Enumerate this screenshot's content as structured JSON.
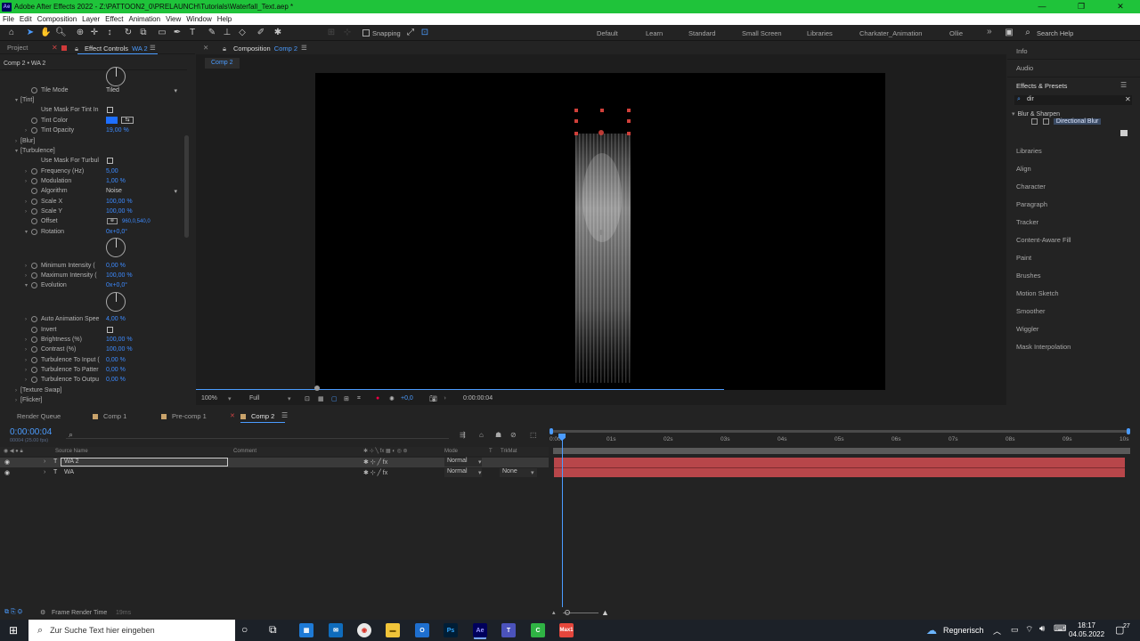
{
  "window": {
    "title": "Adobe After Effects 2022 - Z:\\PATTOON2_0\\PRELAUNCH\\Tutorials\\Waterfall_Text.aep *",
    "app_badge": "Ae",
    "controls": [
      "—",
      "❐",
      "✕"
    ]
  },
  "menu": [
    "File",
    "Edit",
    "Composition",
    "Layer",
    "Effect",
    "Animation",
    "View",
    "Window",
    "Help"
  ],
  "toolbar": {
    "snapping_label": "Snapping",
    "workspaces": [
      "Default",
      "Learn",
      "Standard",
      "Small Screen",
      "Libraries",
      "Charkater_Animation",
      "Ollie"
    ],
    "overflow": "»",
    "search_help": "Search Help"
  },
  "effect_controls": {
    "tabs": [
      "Project",
      "Effect Controls",
      "WA 2"
    ],
    "header": "Comp 2 • WA 2",
    "rows": [
      {
        "label": "Tile Mode",
        "kind": "dropdown",
        "value": "Tiled"
      },
      {
        "label": "[Tint]",
        "kind": "group"
      },
      {
        "label": "Use Mask For Tint In",
        "kind": "checkbox"
      },
      {
        "label": "Tint Color",
        "kind": "color"
      },
      {
        "label": "Tint Opacity",
        "kind": "value",
        "value": "19,00 %"
      },
      {
        "label": "[Blur]",
        "kind": "group"
      },
      {
        "label": "[Turbulence]",
        "kind": "group"
      },
      {
        "label": "Use Mask For Turbul",
        "kind": "checkbox"
      },
      {
        "label": "Frequency (Hz)",
        "kind": "value",
        "value": "5,00"
      },
      {
        "label": "Modulation",
        "kind": "value",
        "value": "1,00 %"
      },
      {
        "label": "Algorithm",
        "kind": "dropdown",
        "value": "Noise"
      },
      {
        "label": "Scale X",
        "kind": "value",
        "value": "100,00 %"
      },
      {
        "label": "Scale Y",
        "kind": "value",
        "value": "100,00 %"
      },
      {
        "label": "Offset",
        "kind": "value",
        "value": "960,0,540,0"
      },
      {
        "label": "Rotation",
        "kind": "value",
        "value": "0x+0,0°"
      },
      {
        "label": "Minimum Intensity (",
        "kind": "value",
        "value": "0,00 %"
      },
      {
        "label": "Maximum Intensity (",
        "kind": "value",
        "value": "100,00 %"
      },
      {
        "label": "Evolution",
        "kind": "value",
        "value": "0x+0,0°"
      },
      {
        "label": "Auto Animation Spee",
        "kind": "value",
        "value": "4,00 %"
      },
      {
        "label": "Invert",
        "kind": "checkbox"
      },
      {
        "label": "Brightness (%)",
        "kind": "value",
        "value": "100,00 %"
      },
      {
        "label": "Contrast (%)",
        "kind": "value",
        "value": "100,00 %"
      },
      {
        "label": "Turbulence To Input (",
        "kind": "value",
        "value": "0,00 %"
      },
      {
        "label": "Turbulence To Patter",
        "kind": "value",
        "value": "0,00 %"
      },
      {
        "label": "Turbulence To Outpu",
        "kind": "value",
        "value": "0,00 %"
      },
      {
        "label": "[Texture Swap]",
        "kind": "group"
      },
      {
        "label": "[Flicker]",
        "kind": "group"
      }
    ]
  },
  "composition": {
    "tab_label": "Composition",
    "tab_name": "Comp 2",
    "breadcrumb": "Comp 2",
    "zoom": "100%",
    "resolution": "Full",
    "exposure": "+0,0",
    "timecode": "0:00:00:04"
  },
  "right_panel": {
    "top_items": [
      "Info",
      "Audio"
    ],
    "effects_presets": "Effects & Presets",
    "search_value": "dir",
    "category": "Blur & Sharpen",
    "result": "Directional Blur",
    "items": [
      "Libraries",
      "Align",
      "Character",
      "Paragraph",
      "Tracker",
      "Content-Aware Fill",
      "Paint",
      "Brushes",
      "Motion Sketch",
      "Smoother",
      "Wiggler",
      "Mask Interpolation"
    ]
  },
  "timeline": {
    "tabs": [
      "Render Queue",
      "Comp 1",
      "Pre-comp 1",
      "Comp 2"
    ],
    "timecode": "0:00:00:04",
    "timecode_sub": "00004 (25.00 fps)",
    "columns": [
      "Source Name",
      "Comment",
      "Mode",
      "T",
      "TrkMat"
    ],
    "layers": [
      {
        "name": "WA 2",
        "mode": "Normal",
        "trkmat": ""
      },
      {
        "name": "WA",
        "mode": "Normal",
        "trkmat": "None"
      }
    ],
    "ruler": [
      "0:00f",
      "01s",
      "02s",
      "03s",
      "04s",
      "05s",
      "06s",
      "07s",
      "08s",
      "09s",
      "10s"
    ],
    "footer_label": "Frame Render Time",
    "footer_value": "19ms"
  },
  "taskbar": {
    "search_placeholder": "Zur Suche Text hier eingeben",
    "weather": "Regnerisch",
    "time": "18:17",
    "date": "04.05.2022",
    "notification_count": "27",
    "max_label": "Max1"
  },
  "colors": {
    "title_green": "#1fc33a",
    "accent_blue": "#3d8bff",
    "layer_bar_red": "#b8464a",
    "handle_red": "#d0403a"
  }
}
